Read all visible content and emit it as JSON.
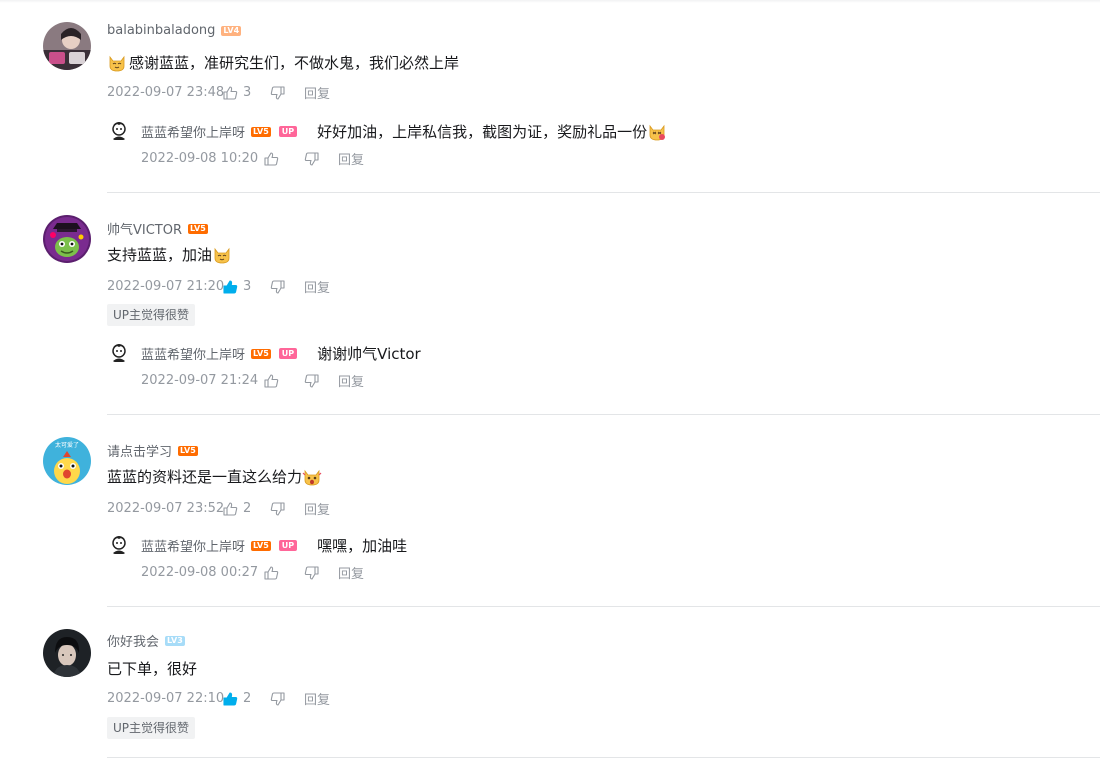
{
  "comments": [
    {
      "username": "balabinbaladong",
      "level": "LV4",
      "text": "感谢蓝蓝，准研究生们，不做水鬼，我们必然上岸",
      "date": "2022-09-07 23:48",
      "likes": "3",
      "reply_label": "回复",
      "reply": {
        "username": "蓝蓝希望你上岸呀",
        "level": "LV5",
        "up_badge": "UP",
        "text": "好好加油，上岸私信我，截图为证，奖励礼品一份",
        "date": "2022-09-08 10:20",
        "reply_label": "回复"
      }
    },
    {
      "username": "帅气VICTOR",
      "level": "LV5",
      "text": "支持蓝蓝，加油",
      "date": "2022-09-07 21:20",
      "likes": "3",
      "reply_label": "回复",
      "up_liked": "UP主觉得很赞",
      "reply": {
        "username": "蓝蓝希望你上岸呀",
        "level": "LV5",
        "up_badge": "UP",
        "text": "谢谢帅气Victor",
        "date": "2022-09-07 21:24",
        "reply_label": "回复"
      }
    },
    {
      "username": "请点击学习",
      "level": "LV5",
      "text": "蓝蓝的资料还是一直这么给力",
      "date": "2022-09-07 23:52",
      "likes": "2",
      "reply_label": "回复",
      "reply": {
        "username": "蓝蓝希望你上岸呀",
        "level": "LV5",
        "up_badge": "UP",
        "text": "嘿嘿，加油哇",
        "date": "2022-09-08 00:27",
        "reply_label": "回复"
      }
    },
    {
      "username": "你好我会",
      "level": "LV3",
      "text": "已下单，很好",
      "date": "2022-09-07 22:10",
      "likes": "2",
      "reply_label": "回复",
      "up_liked": "UP主觉得很赞"
    }
  ],
  "avatar3_caption": "太可爱了",
  "colors": {
    "level4": "#ffb27f",
    "level5": "#ff6c00",
    "level3": "#a7dcf8",
    "up_badge": "#ff6699",
    "liked_blue": "#00aeec"
  },
  "icons": [
    "thumb-up-icon",
    "thumb-down-icon",
    "cat-emoji-icon",
    "surprised-emoji-icon"
  ]
}
